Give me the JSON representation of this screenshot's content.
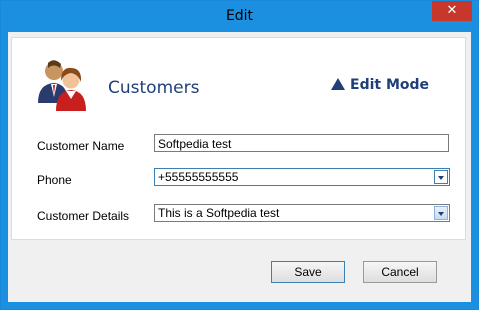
{
  "window": {
    "title": "Edit",
    "close_glyph": "✕"
  },
  "header": {
    "title": "Customers",
    "icon": "customers-icon",
    "mode_label": "Edit Mode",
    "mode_icon": "triangle-up-icon"
  },
  "form": {
    "name_label": "Customer Name",
    "name_value": "Softpedia test",
    "phone_label": "Phone",
    "phone_value": "+55555555555",
    "details_label": "Customer Details",
    "details_value": "This is a Softpedia test"
  },
  "buttons": {
    "save": "Save",
    "cancel": "Cancel"
  },
  "colors": {
    "titlebar": "#1b8fe0",
    "accent_text": "#1f3f7a",
    "close": "#c7372c"
  }
}
